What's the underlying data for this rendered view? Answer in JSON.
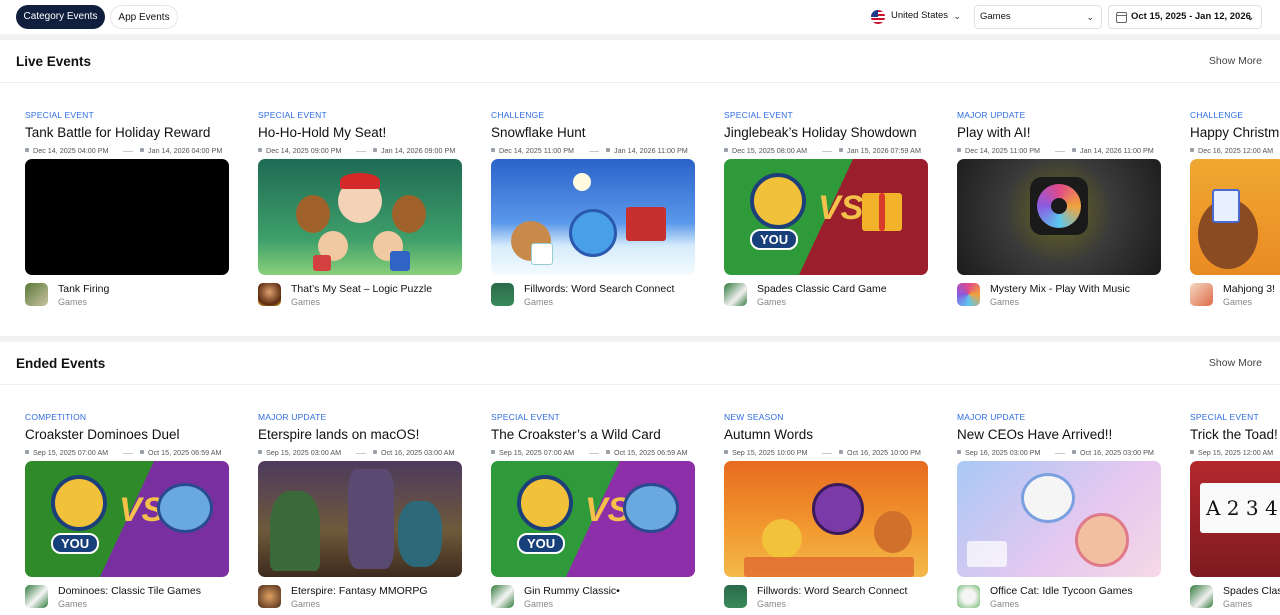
{
  "topbar": {
    "tabs": [
      "Category Events",
      "App Events"
    ],
    "country": "United States",
    "category": "Games",
    "date_range": "Oct 15, 2025 - Jan 12, 2026"
  },
  "sections": {
    "live": {
      "title": "Live Events",
      "show_more": "Show More",
      "cards": [
        {
          "type": "SPECIAL EVENT",
          "title": "Tank Battle for Holiday Reward",
          "start": "Dec 14, 2025 04:00 PM",
          "end": "Jan 14, 2026 04:00 PM",
          "app": "Tank Firing",
          "category": "Games"
        },
        {
          "type": "SPECIAL EVENT",
          "title": "Ho-Ho-Hold My Seat!",
          "start": "Dec 14, 2025 09:00 PM",
          "end": "Jan 14, 2026 09:00 PM",
          "app": "That’s My Seat – Logic Puzzle",
          "category": "Games"
        },
        {
          "type": "CHALLENGE",
          "title": "Snowflake Hunt",
          "start": "Dec 14, 2025 11:00 PM",
          "end": "Jan 14, 2026 11:00 PM",
          "app": "Fillwords: Word Search Connect",
          "category": "Games"
        },
        {
          "type": "SPECIAL EVENT",
          "title": "Jinglebeak’s Holiday Showdown",
          "start": "Dec 15, 2025 08:00 AM",
          "end": "Jan 15, 2026 07:59 AM",
          "app": "Spades Classic Card Game",
          "category": "Games"
        },
        {
          "type": "MAJOR UPDATE",
          "title": "Play with AI!",
          "start": "Dec 14, 2025 11:00 PM",
          "end": "Jan 14, 2026 11:00 PM",
          "app": "Mystery Mix - Play With Music",
          "category": "Games"
        },
        {
          "type": "CHALLENGE",
          "title": "Happy Christm",
          "start": "Dec 16, 2025 12:00 AM",
          "end": "",
          "app": "Mahjong 3!",
          "category": "Games"
        }
      ]
    },
    "ended": {
      "title": "Ended Events",
      "show_more": "Show More",
      "cards": [
        {
          "type": "COMPETITION",
          "title": "Croakster Dominoes Duel",
          "start": "Sep 15, 2025 07:00 AM",
          "end": "Oct 15, 2025 06:59 AM",
          "app": "Dominoes: Classic Tile Games",
          "category": "Games"
        },
        {
          "type": "MAJOR UPDATE",
          "title": "Eterspire lands on macOS!",
          "start": "Sep 15, 2025 03:00 AM",
          "end": "Oct 16, 2025 03:00 AM",
          "app": "Eterspire: Fantasy MMORPG",
          "category": "Games"
        },
        {
          "type": "SPECIAL EVENT",
          "title": "The Croakster’s a Wild Card",
          "start": "Sep 15, 2025 07:00 AM",
          "end": "Oct 15, 2025 06:59 AM",
          "app": "Gin Rummy Classic•",
          "category": "Games"
        },
        {
          "type": "NEW SEASON",
          "title": "Autumn Words",
          "start": "Sep 15, 2025 10:00 PM",
          "end": "Oct 16, 2025 10:00 PM",
          "app": "Fillwords: Word Search Connect",
          "category": "Games"
        },
        {
          "type": "MAJOR UPDATE",
          "title": "New CEOs Have Arrived!!",
          "start": "Sep 16, 2025 03:00 PM",
          "end": "Oct 16, 2025 03:00 PM",
          "app": "Office Cat: Idle Tycoon Games",
          "category": "Games"
        },
        {
          "type": "SPECIAL EVENT",
          "title": "Trick the Toad!",
          "start": "Sep 15, 2025 12:00 AM",
          "end": "",
          "app": "Spades Clas",
          "category": "Games"
        }
      ]
    }
  },
  "art_labels": {
    "you": "YOU",
    "vs": "VS",
    "cards": "A 2 3 4"
  },
  "icons": {
    "flag": "us-flag-icon",
    "chevron": "chevron-down-icon",
    "calendar": "calendar-icon"
  },
  "colors": {
    "accent": "#2f6de0",
    "tab_active_bg": "#0f1f3d"
  }
}
